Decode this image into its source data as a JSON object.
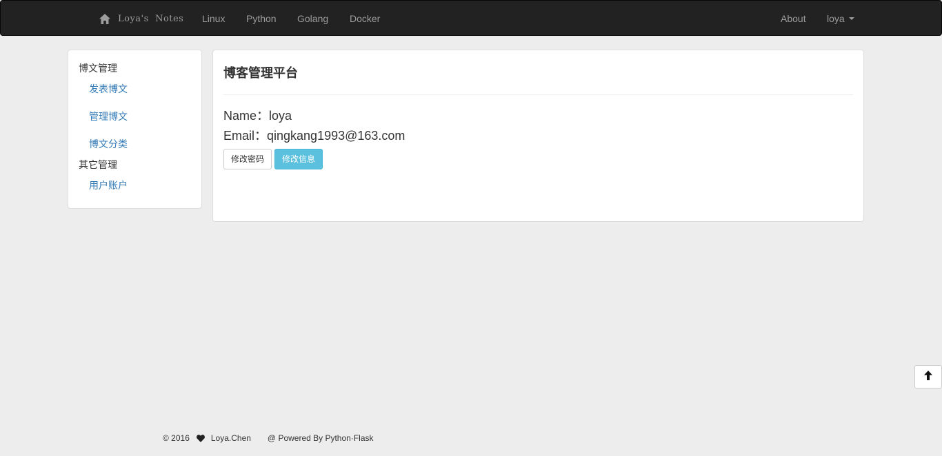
{
  "navbar": {
    "brand": "Loya's  Notes",
    "links": [
      "Linux",
      "Python",
      "Golang",
      "Docker"
    ],
    "about": "About",
    "user": "loya"
  },
  "sidebar": {
    "section1": "博文管理",
    "items1": [
      "发表博文",
      "管理博文",
      "博文分类"
    ],
    "section2": "其它管理",
    "items2": [
      "用户账户"
    ]
  },
  "main": {
    "title": "博客管理平台",
    "name_line": "Name：loya",
    "email_line": "Email：qingkang1993@163.com",
    "change_password": "修改密码",
    "edit_info": "修改信息"
  },
  "footer": {
    "copyright": "© 2016",
    "author": "Loya.Chen",
    "powered": "@ Powered By Python·Flask"
  }
}
